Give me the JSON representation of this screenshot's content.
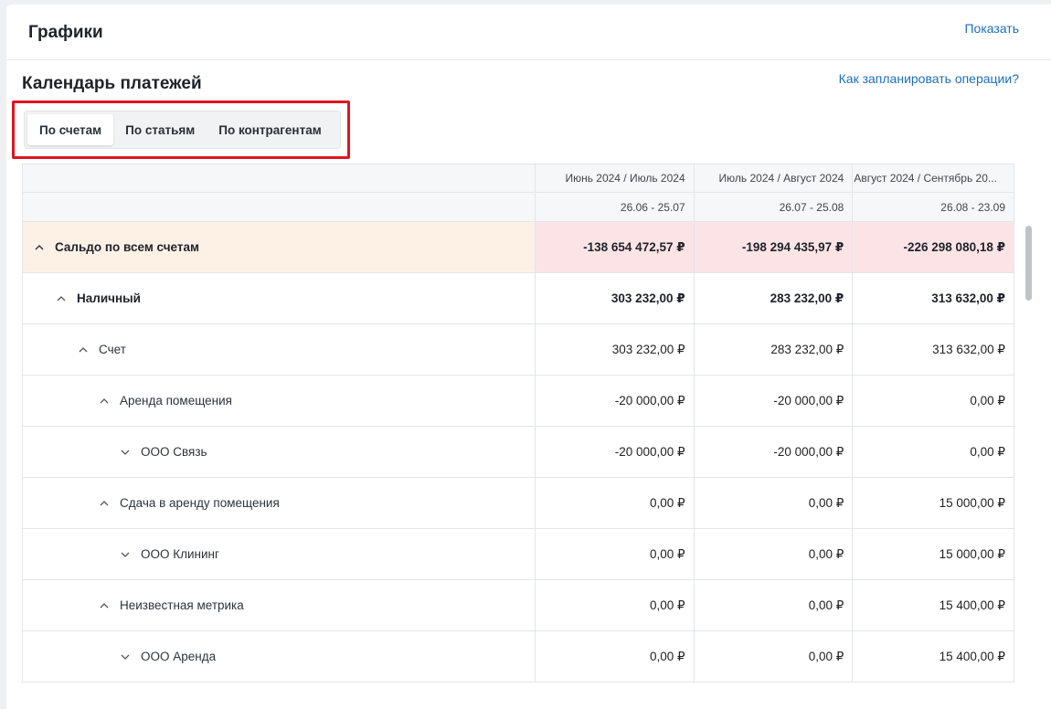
{
  "header": {
    "title": "Графики",
    "show_link": "Показать"
  },
  "section": {
    "title": "Календарь платежей",
    "help_link": "Как запланировать операции?"
  },
  "tabs": [
    {
      "label": "По счетам",
      "active": true
    },
    {
      "label": "По статьям",
      "active": false
    },
    {
      "label": "По контрагентам",
      "active": false
    }
  ],
  "columns": [
    {
      "period": "Июнь 2024 / Июль 2024",
      "range": "26.06 - 25.07"
    },
    {
      "period": "Июль 2024 / Август 2024",
      "range": "26.07 - 25.08"
    },
    {
      "period": "Август 2024 / Сентябрь 20...",
      "range": "26.08 - 23.09"
    }
  ],
  "rows": [
    {
      "label": "Сальдо по всем счетам",
      "values": [
        "-138 654 472,57 ₽",
        "-198 294 435,97 ₽",
        "-226 298 080,18 ₽"
      ]
    },
    {
      "label": "Наличный",
      "values": [
        "303 232,00 ₽",
        "283 232,00 ₽",
        "313 632,00 ₽"
      ]
    },
    {
      "label": "Счет",
      "values": [
        "303 232,00 ₽",
        "283 232,00 ₽",
        "313 632,00 ₽"
      ]
    },
    {
      "label": "Аренда помещения",
      "values": [
        "-20 000,00 ₽",
        "-20 000,00 ₽",
        "0,00 ₽"
      ]
    },
    {
      "label": "ООО Связь",
      "values": [
        "-20 000,00 ₽",
        "-20 000,00 ₽",
        "0,00 ₽"
      ]
    },
    {
      "label": "Сдача в аренду помещения",
      "values": [
        "0,00 ₽",
        "0,00 ₽",
        "15 000,00 ₽"
      ]
    },
    {
      "label": "ООО Клининг",
      "values": [
        "0,00 ₽",
        "0,00 ₽",
        "15 000,00 ₽"
      ]
    },
    {
      "label": "Неизвестная метрика",
      "values": [
        "0,00 ₽",
        "0,00 ₽",
        "15 400,00 ₽"
      ]
    },
    {
      "label": "ООО Аренда",
      "values": [
        "0,00 ₽",
        "0,00 ₽",
        "15 400,00 ₽"
      ]
    }
  ]
}
